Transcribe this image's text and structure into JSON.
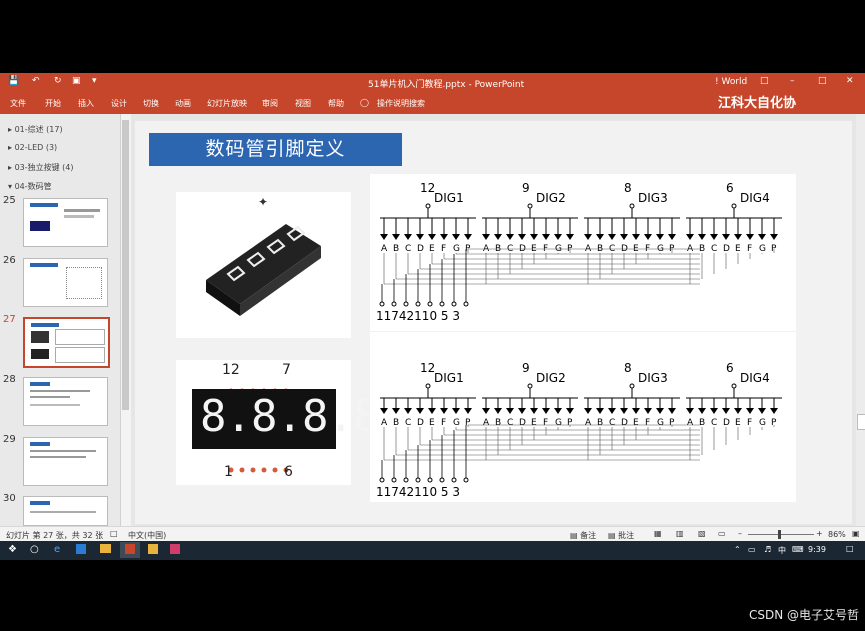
{
  "window": {
    "title": "51单片机入门教程.pptx  -  PowerPoint",
    "account": "! World"
  },
  "ribbon": {
    "tabs": [
      "文件",
      "开始",
      "插入",
      "设计",
      "切换",
      "动画",
      "幻灯片放映",
      "审阅",
      "视图",
      "帮助"
    ],
    "tell_me": "操作说明搜索",
    "overlay_brand": "江科大自化协"
  },
  "outline": {
    "sections": [
      "01-综述 (17)",
      "02-LED (3)",
      "03-独立按键 (4)",
      "04-数码管"
    ],
    "slide_numbers": [
      "25",
      "26",
      "27",
      "28",
      "29",
      "30"
    ],
    "current_slide": "27"
  },
  "slide": {
    "title": "数码管引脚定义",
    "photo2_pins_top": [
      "12",
      "7"
    ],
    "photo2_pins_bottom": [
      "1",
      "6"
    ],
    "display_digits": "8.8.8.8."
  },
  "diagram1": {
    "dig_labels": [
      "DIG1",
      "DIG2",
      "DIG3",
      "DIG4"
    ],
    "dig_pins": [
      "12",
      "9",
      "8",
      "6"
    ],
    "segments": [
      "A",
      "B",
      "C",
      "D",
      "E",
      "F",
      "G",
      "DP"
    ],
    "bottom_pins": "11742110 5 3"
  },
  "diagram2": {
    "dig_labels": [
      "DIG1",
      "DIG2",
      "DIG3",
      "DIG4"
    ],
    "dig_pins": [
      "12",
      "9",
      "8",
      "6"
    ],
    "segments": [
      "A",
      "B",
      "C",
      "D",
      "E",
      "F",
      "G",
      "DP"
    ],
    "bottom_pins": "11742110 5 3"
  },
  "statusbar": {
    "slide_info": "幻灯片 第 27 张，共 32 张",
    "language": "中文(中国)",
    "notes": "备注",
    "comments": "批注",
    "zoom": "86%"
  },
  "taskbar": {
    "time": "9:39",
    "ime": "中"
  },
  "watermark": "CSDN @电子艾号哲",
  "colors": {
    "ppt_orange": "#c5462a",
    "title_blue": "#2c65b0",
    "taskbar": "#1b2733"
  }
}
